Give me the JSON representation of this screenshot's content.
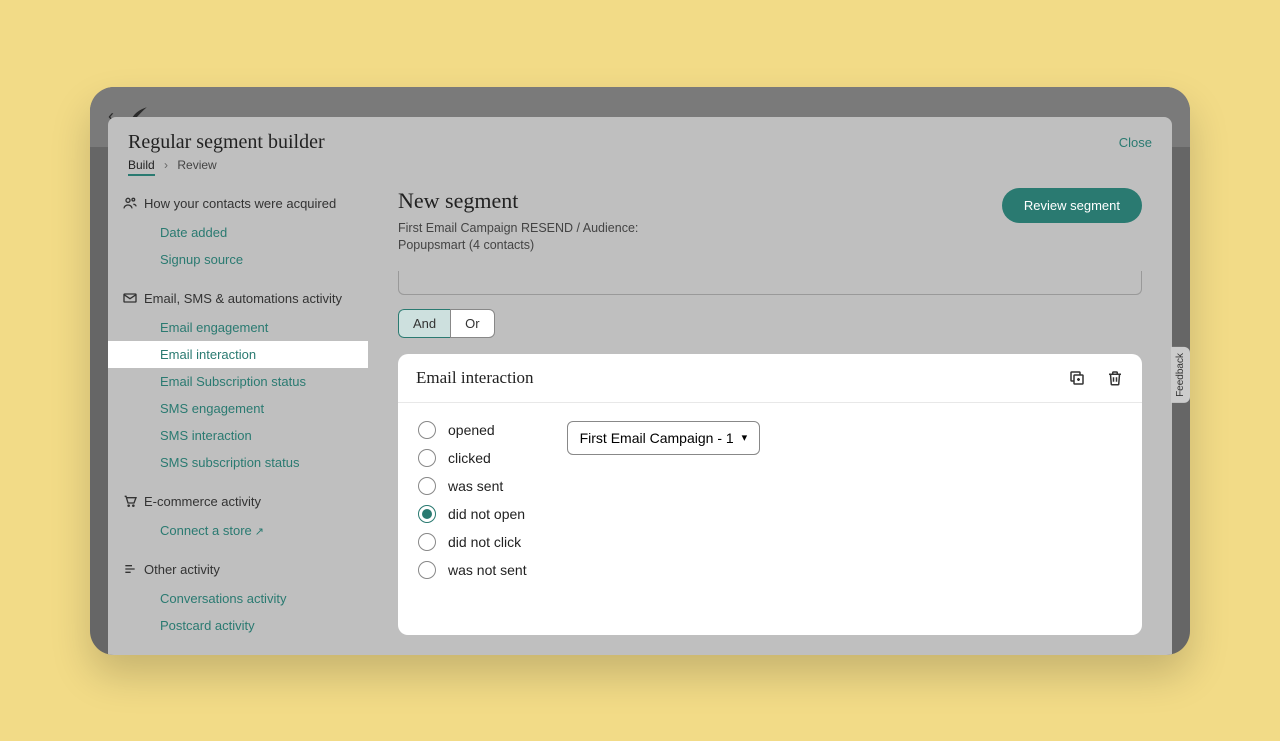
{
  "modal": {
    "title": "Regular segment builder",
    "breadcrumb": {
      "step1": "Build",
      "step2": "Review"
    },
    "close": "Close"
  },
  "sidebar": {
    "groups": [
      {
        "header": "How your contacts were acquired",
        "items": [
          "Date added",
          "Signup source"
        ]
      },
      {
        "header": "Email, SMS & automations activity",
        "items": [
          "Email engagement",
          "Email interaction",
          "Email Subscription status",
          "SMS engagement",
          "SMS interaction",
          "SMS subscription status"
        ],
        "activeIndex": 1
      },
      {
        "header": "E-commerce activity",
        "items": [
          "Connect a store"
        ]
      },
      {
        "header": "Other activity",
        "items": [
          "Conversations activity",
          "Postcard activity"
        ]
      }
    ]
  },
  "main": {
    "segmentTitle": "New segment",
    "segmentSub": "First Email Campaign RESEND / Audience: Popupsmart (4 contacts)",
    "reviewBtn": "Review segment",
    "andor": {
      "and": "And",
      "or": "Or",
      "selected": "and"
    },
    "cardTitle": "Email interaction",
    "radios": [
      "opened",
      "clicked",
      "was sent",
      "did not open",
      "did not click",
      "was not sent"
    ],
    "selectedRadio": 3,
    "campaignSelect": "First Email Campaign - 1"
  },
  "feedback": "Feedback"
}
